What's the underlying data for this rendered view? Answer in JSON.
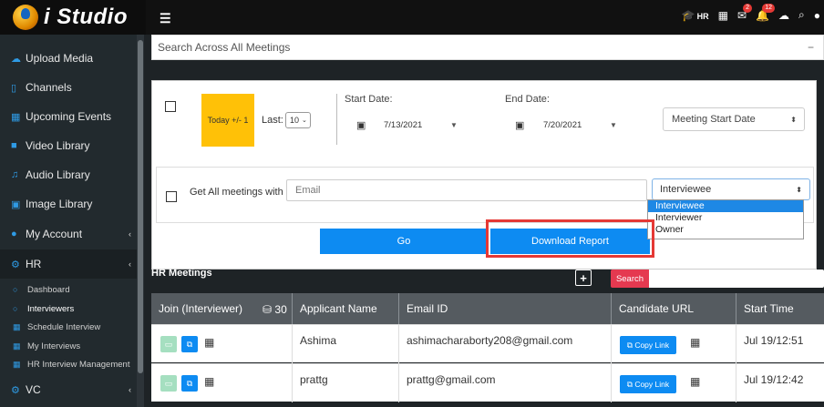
{
  "app": {
    "logo_text": "i Studio"
  },
  "topbar": {
    "hr_label": "HR",
    "notif_badge_1": "2",
    "notif_badge_2": "12"
  },
  "sidebar": {
    "items": [
      {
        "label": "Upload Media"
      },
      {
        "label": "Channels"
      },
      {
        "label": "Upcoming Events"
      },
      {
        "label": "Video Library"
      },
      {
        "label": "Audio Library"
      },
      {
        "label": "Image Library"
      },
      {
        "label": "My Account"
      },
      {
        "label": "HR"
      }
    ],
    "hr_sub": [
      {
        "label": "Dashboard"
      },
      {
        "label": "Interviewers"
      },
      {
        "label": "Schedule Interview"
      },
      {
        "label": "My Interviews"
      },
      {
        "label": "HR Interview Management"
      }
    ],
    "vc_label": "VC"
  },
  "search": {
    "label": "Search Across All Meetings"
  },
  "filters": {
    "today_label": "Today +/- 1",
    "last_label": "Last:",
    "last_value": "10",
    "start_label": "Start Date:",
    "start_value": "7/13/2021",
    "end_label": "End Date:",
    "end_value": "7/20/2021",
    "sort_value": "Meeting Start Date",
    "get_all_label": "Get All meetings with",
    "email_placeholder": "Email",
    "role_value": "Interviewee",
    "role_options": [
      "Interviewee",
      "Interviewer",
      "Owner"
    ],
    "go_label": "Go",
    "download_label": "Download Report"
  },
  "meetings": {
    "title": "HR Meetings",
    "search_label": "Search",
    "count": "30",
    "columns": [
      "Join (Interviewer)",
      "Applicant Name",
      "Email ID",
      "Candidate URL",
      "Start Time"
    ],
    "copy_label": "Copy Link",
    "rows": [
      {
        "name": "Ashima",
        "email": "ashimacharaborty208@gmail.com",
        "start": "Jul 19/12:51"
      },
      {
        "name": "prattg",
        "email": "prattg@gmail.com",
        "start": "Jul 19/12:42"
      }
    ]
  }
}
